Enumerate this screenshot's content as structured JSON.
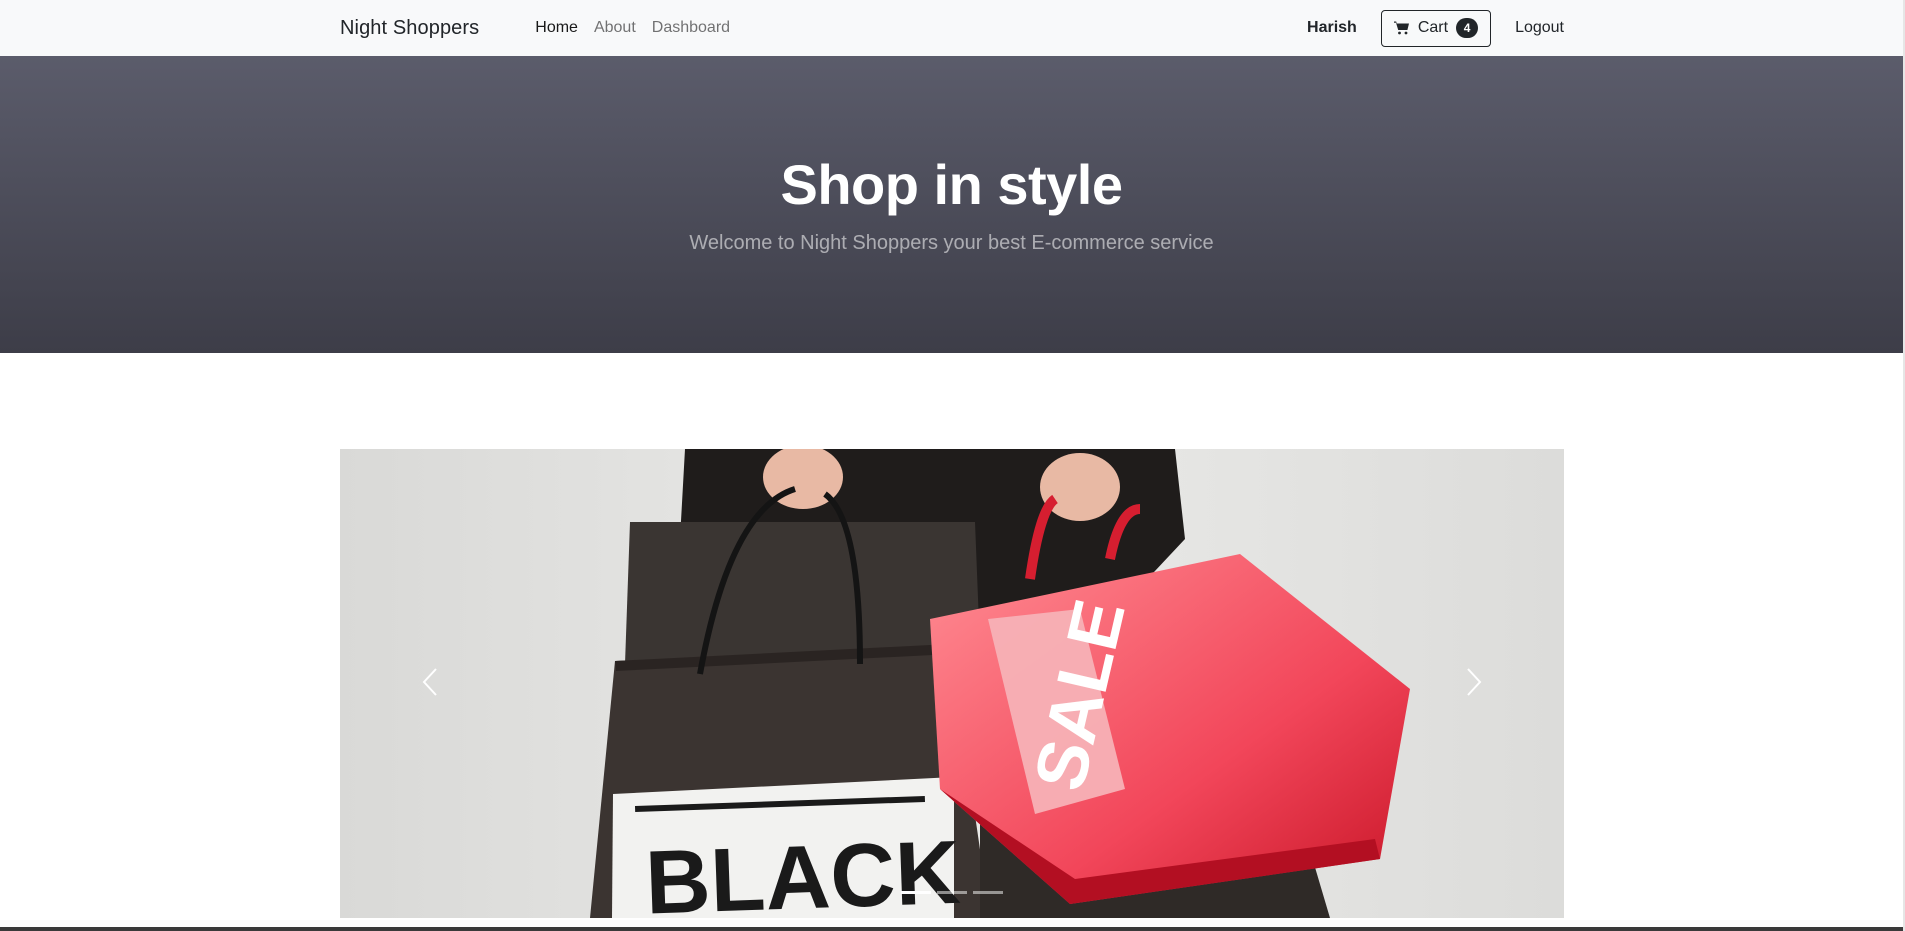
{
  "navbar": {
    "brand": "Night Shoppers",
    "links": [
      {
        "label": "Home",
        "active": true
      },
      {
        "label": "About",
        "active": false
      },
      {
        "label": "Dashboard",
        "active": false
      }
    ],
    "username": "Harish",
    "cart_label": "Cart",
    "cart_count": "4",
    "logout_label": "Logout",
    "cart_icon": "shopping-cart-icon"
  },
  "hero": {
    "title": "Shop in style",
    "subtitle": "Welcome to Night Shoppers your best E-commerce service",
    "gradient_top": "#5b5c6b",
    "gradient_bottom": "#3d3d48"
  },
  "carousel": {
    "slide_text_left": "BLACK",
    "slide_text_tag": "SALE",
    "prev_icon": "chevron-left-icon",
    "next_icon": "chevron-right-icon",
    "indicators": [
      {
        "active": true
      },
      {
        "active": false
      },
      {
        "active": false
      }
    ],
    "bag_red": "#e8283a",
    "bag_black": "#2f2a27"
  }
}
